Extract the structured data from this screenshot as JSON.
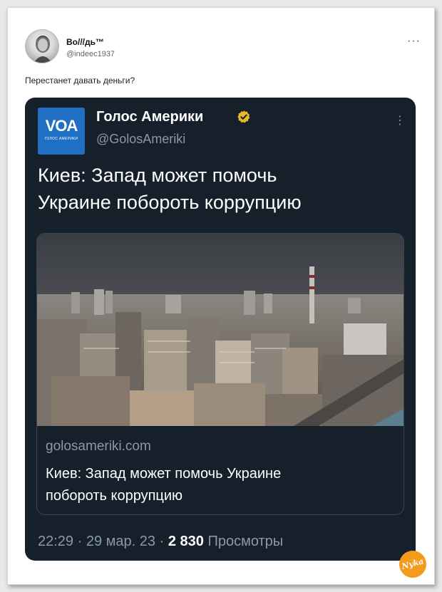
{
  "post": {
    "author_name": "Во///дь™",
    "author_handle": "@indeec1937",
    "more_label": "···",
    "text": "Перестанет давать деньги?"
  },
  "quoted": {
    "logo_text": "VOA",
    "logo_subtext": "ГОЛОС АМЕРИКИ",
    "source_name": "Голос Америки",
    "source_handle": "@GolosAmeriki",
    "more_label": "⋮",
    "headline_line1": "Киев: Запад может помочь",
    "headline_line2": "Украине побороть коррупцию",
    "link": {
      "domain": "golosameriki.com",
      "title_line1": "Киев: Запад может помочь Украине",
      "title_line2": "побороть коррупцию"
    },
    "meta": {
      "time": "22:29",
      "date": "29 мар. 23",
      "views_count": "2 830",
      "views_label": "Просмотры",
      "separator": "·"
    },
    "verified_icon": "verified-badge-icon",
    "accent_color": "#1f6fc4",
    "background_color": "#15202b"
  },
  "watermark": {
    "text": "Nyka"
  }
}
